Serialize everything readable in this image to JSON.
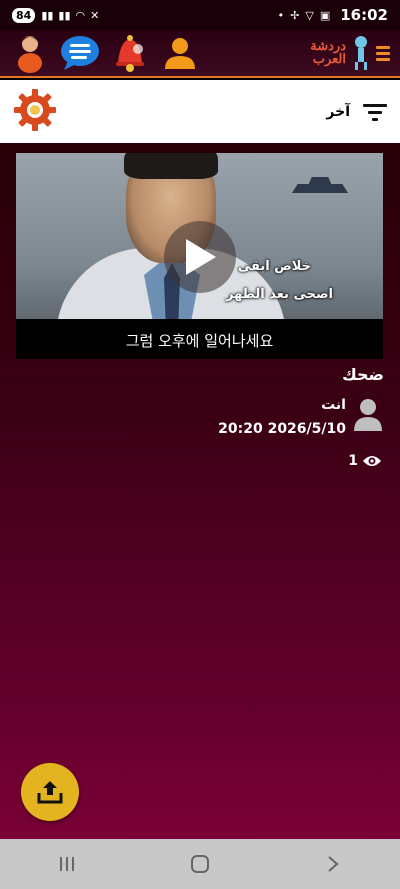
{
  "status_bar": {
    "battery": "84",
    "time": "16:02"
  },
  "header": {
    "brand_name_line1": "دردشة",
    "brand_name_line2": "العرب",
    "icons": [
      "contact-avatar-icon",
      "chat-bubble-icon",
      "notification-bell-icon",
      "profile-icon"
    ]
  },
  "toolbar": {
    "filter_label": "آخر"
  },
  "post": {
    "video": {
      "subtitle_ar_line1": "خلاص ابقى",
      "subtitle_ar_line2": "اصحى بعد الظهر",
      "subtitle_ko": "그럼 오후에 일어나세요"
    },
    "title": "ضحك",
    "author": "انت",
    "date": "20:20 2026/5/10",
    "views": "1"
  },
  "colors": {
    "accent": "#e07a25",
    "fab": "#e3b320",
    "content_top": "#260006",
    "content_bottom": "#7a0035"
  }
}
